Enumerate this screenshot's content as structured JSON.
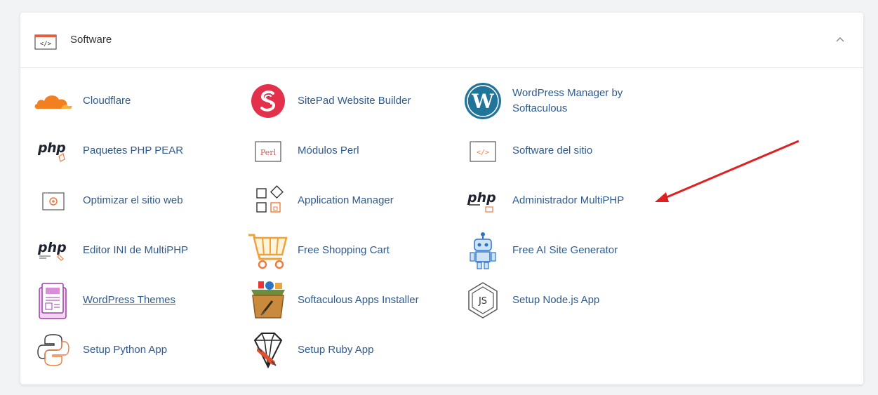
{
  "panel": {
    "title": "Software",
    "header_icon": "code-window-icon",
    "collapse_icon": "chevron-up-icon"
  },
  "items": [
    {
      "label": "Cloudflare",
      "icon": "cloudflare-icon"
    },
    {
      "label": "SitePad Website Builder",
      "icon": "sitepad-icon"
    },
    {
      "label": "WordPress Manager by Softaculous",
      "icon": "wordpress-icon"
    },
    {
      "label": "Paquetes PHP PEAR",
      "icon": "php-pear-icon"
    },
    {
      "label": "Módulos Perl",
      "icon": "perl-icon"
    },
    {
      "label": "Software del sitio",
      "icon": "code-window-icon"
    },
    {
      "label": "Optimizar el sitio web",
      "icon": "optimize-gear-icon"
    },
    {
      "label": "Application Manager",
      "icon": "app-manager-icon"
    },
    {
      "label": "Administrador MultiPHP",
      "icon": "php-manager-icon"
    },
    {
      "label": "Editor INI de MultiPHP",
      "icon": "php-ini-editor-icon"
    },
    {
      "label": "Free Shopping Cart",
      "icon": "shopping-cart-icon"
    },
    {
      "label": "Free AI Site Generator",
      "icon": "robot-icon"
    },
    {
      "label": "WordPress Themes",
      "icon": "wordpress-themes-icon"
    },
    {
      "label": "Softaculous Apps Installer",
      "icon": "softaculous-icon"
    },
    {
      "label": "Setup Node.js App",
      "icon": "nodejs-icon"
    },
    {
      "label": "Setup Python App",
      "icon": "python-icon"
    },
    {
      "label": "Setup Ruby App",
      "icon": "ruby-icon"
    }
  ],
  "annotation": {
    "icon": "red-arrow-icon",
    "color": "#e02020"
  },
  "colors": {
    "link": "#2f5b8e",
    "accent_orange": "#f07b3f"
  }
}
